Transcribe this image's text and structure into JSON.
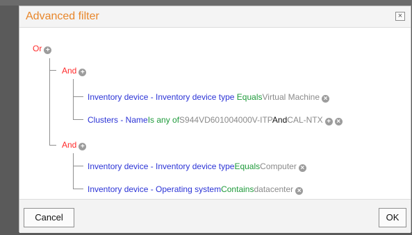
{
  "dialog": {
    "title": "Advanced filter",
    "close_glyph": "×"
  },
  "tree": {
    "root_op": "Or",
    "groups": [
      {
        "op": "And",
        "rules": [
          {
            "field": "Inventory device - Inventory device type",
            "comparator": "Equals",
            "value": "Virtual Machine"
          },
          {
            "field": "Clusters - Name",
            "comparator": "Is any of",
            "value": "S944VD601004000V-ITP",
            "join": "And",
            "value2": "CAL-NTX"
          }
        ]
      },
      {
        "op": "And",
        "rules": [
          {
            "field": "Inventory device - Inventory device type",
            "comparator": "Equals",
            "value": "Computer"
          },
          {
            "field": "Inventory device - Operating system",
            "comparator": "Contains",
            "value": "datacenter"
          }
        ]
      }
    ]
  },
  "icons": {
    "add": "+",
    "remove": "×"
  },
  "footer": {
    "cancel_label": "Cancel",
    "ok_label": "OK"
  }
}
